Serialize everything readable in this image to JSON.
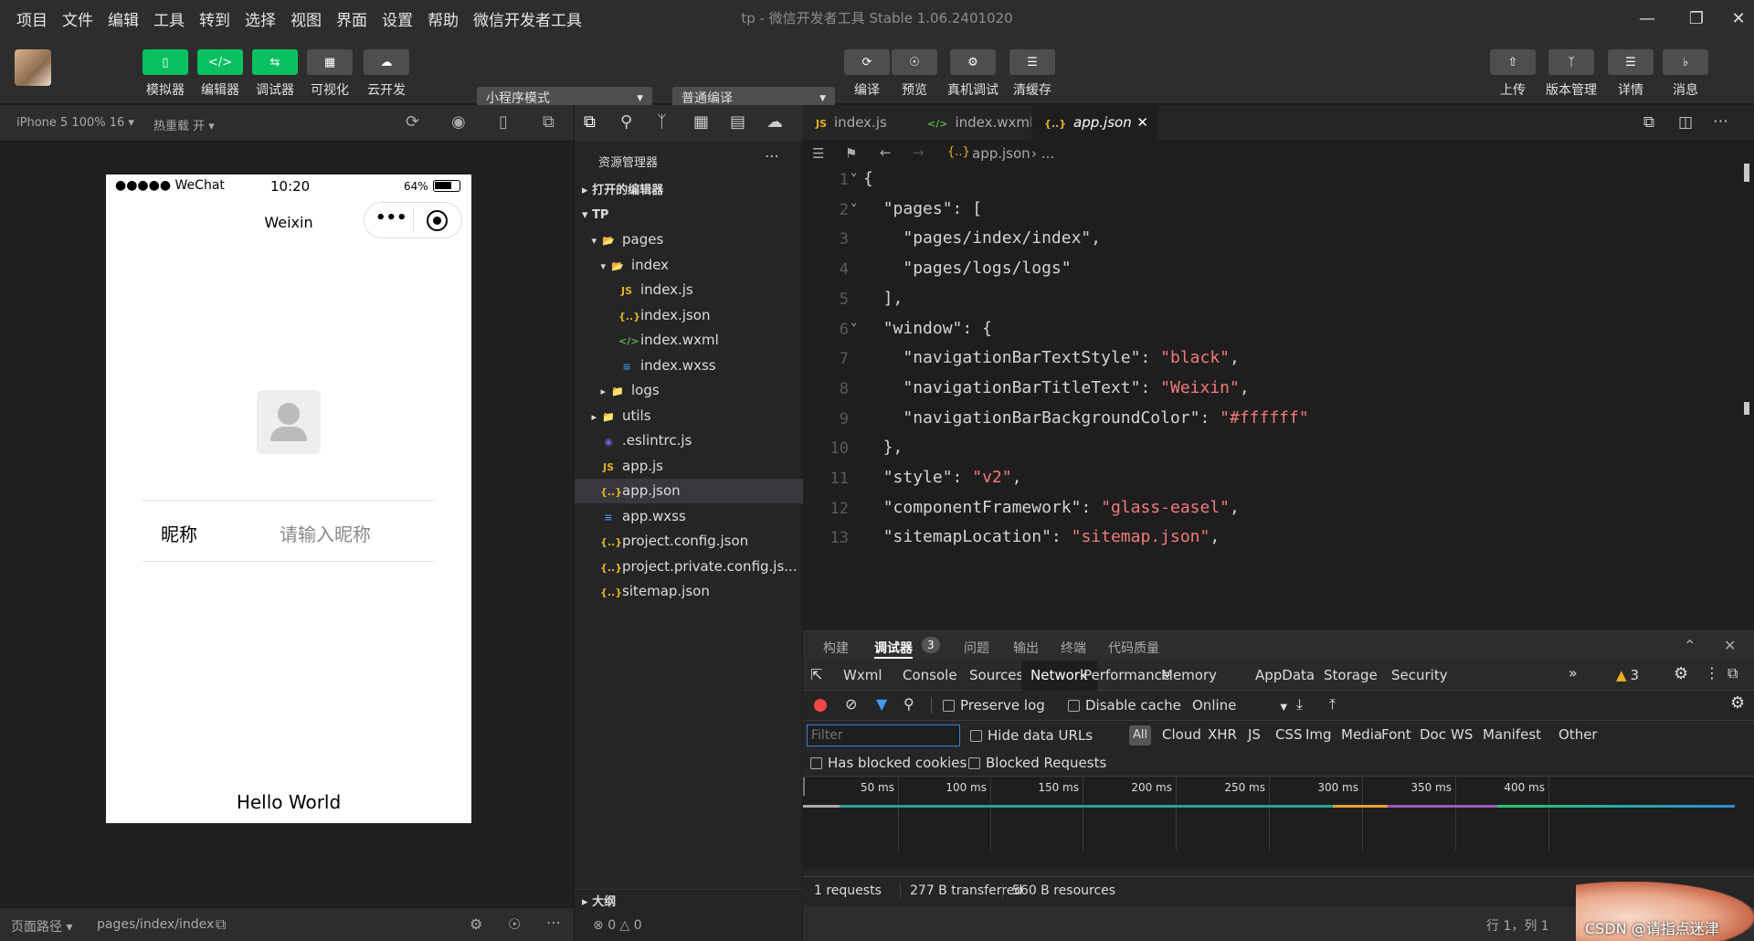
{
  "menu": [
    "项目",
    "文件",
    "编辑",
    "工具",
    "转到",
    "选择",
    "视图",
    "界面",
    "设置",
    "帮助",
    "微信开发者工具"
  ],
  "window_title": "tp - 微信开发者工具 Stable 1.06.2401020",
  "toolbar": {
    "left_buttons": [
      {
        "label": "模拟器",
        "icon": "phone-icon",
        "color": "green"
      },
      {
        "label": "编辑器",
        "icon": "code-icon",
        "color": "green"
      },
      {
        "label": "调试器",
        "icon": "debug-icon",
        "color": "green"
      },
      {
        "label": "可视化",
        "icon": "layout-icon",
        "color": "grey"
      },
      {
        "label": "云开发",
        "icon": "cloud-icon",
        "color": "grey"
      }
    ],
    "mode_select": "小程序模式",
    "compile_select": "普通编译",
    "mid_buttons": [
      {
        "label": "编译",
        "icon": "refresh-icon"
      },
      {
        "label": "预览",
        "icon": "eye-icon"
      },
      {
        "label": "真机调试",
        "icon": "bug-icon"
      },
      {
        "label": "清缓存",
        "icon": "layers-icon"
      }
    ],
    "right_buttons": [
      {
        "label": "上传",
        "icon": "upload-icon"
      },
      {
        "label": "版本管理",
        "icon": "branch-icon"
      },
      {
        "label": "详情",
        "icon": "menu-icon"
      },
      {
        "label": "消息",
        "icon": "bell-icon"
      }
    ]
  },
  "simulator": {
    "device": "iPhone 5 100% 16",
    "hot_reload": "热重载 开",
    "phone": {
      "carrier": "●●●●● WeChat",
      "time": "10:20",
      "battery": "64%",
      "nav_title": "Weixin",
      "nickname_label": "昵称",
      "nickname_placeholder": "请输入昵称",
      "motto": "Hello World"
    },
    "footer_label": "页面路径",
    "footer_path": "pages/index/index"
  },
  "explorer": {
    "title": "资源管理器",
    "open_editors": "打开的编辑器",
    "root": "TP",
    "outline": "大纲",
    "status_errors": "0",
    "status_warnings": "0",
    "files": [
      {
        "name": "pages",
        "indent": 1,
        "type": "folder-open",
        "arrow": "▾"
      },
      {
        "name": "index",
        "indent": 2,
        "type": "folder-open",
        "arrow": "▾"
      },
      {
        "name": "index.js",
        "indent": 3,
        "type": "js"
      },
      {
        "name": "index.json",
        "indent": 3,
        "type": "json"
      },
      {
        "name": "index.wxml",
        "indent": 3,
        "type": "wxml"
      },
      {
        "name": "index.wxss",
        "indent": 3,
        "type": "wxss"
      },
      {
        "name": "logs",
        "indent": 2,
        "type": "folder",
        "arrow": "▸"
      },
      {
        "name": "utils",
        "indent": 1,
        "type": "folder",
        "arrow": "▸"
      },
      {
        "name": ".eslintrc.js",
        "indent": 1,
        "type": "eslint"
      },
      {
        "name": "app.js",
        "indent": 1,
        "type": "js"
      },
      {
        "name": "app.json",
        "indent": 1,
        "type": "json",
        "selected": true
      },
      {
        "name": "app.wxss",
        "indent": 1,
        "type": "wxss"
      },
      {
        "name": "project.config.json",
        "indent": 1,
        "type": "json"
      },
      {
        "name": "project.private.config.js...",
        "indent": 1,
        "type": "json"
      },
      {
        "name": "sitemap.json",
        "indent": 1,
        "type": "json"
      }
    ]
  },
  "editor": {
    "tabs": [
      {
        "name": "index.js",
        "type": "js"
      },
      {
        "name": "index.wxml",
        "type": "wxml"
      },
      {
        "name": "app.json",
        "type": "json",
        "active": true
      }
    ],
    "breadcrumb_file": "app.json",
    "breadcrumb_more": "...",
    "lines": [
      {
        "n": "1",
        "text": "{"
      },
      {
        "n": "2",
        "text": "  \"pages\": ["
      },
      {
        "n": "3",
        "text": "    \"pages/index/index\","
      },
      {
        "n": "4",
        "text": "    \"pages/logs/logs\""
      },
      {
        "n": "5",
        "text": "  ],"
      },
      {
        "n": "6",
        "text": "  \"window\": {"
      },
      {
        "n": "7",
        "text": "    \"navigationBarTextStyle\": \"black\","
      },
      {
        "n": "8",
        "text": "    \"navigationBarTitleText\": \"Weixin\","
      },
      {
        "n": "9",
        "text": "    \"navigationBarBackgroundColor\": \"#ffffff\""
      },
      {
        "n": "10",
        "text": "  },"
      },
      {
        "n": "11",
        "text": "  \"style\": \"v2\","
      },
      {
        "n": "12",
        "text": "  \"componentFramework\": \"glass-easel\","
      },
      {
        "n": "13",
        "text": "  \"sitemapLocation\": \"sitemap.json\","
      }
    ],
    "cursor": "行 1，列 1"
  },
  "devtools": {
    "top_tabs": [
      "构建",
      "调试器",
      "问题",
      "输出",
      "终端",
      "代码质量"
    ],
    "debugger_badge": "3",
    "tabs": [
      "Wxml",
      "Console",
      "Sources",
      "Network",
      "Performance",
      "Memory",
      "AppData",
      "Storage",
      "Security"
    ],
    "active_tab": "Network",
    "warn_count": "3",
    "preserve_log": "Preserve log",
    "disable_cache": "Disable cache",
    "throttle": "Online",
    "filter_placeholder": "Filter",
    "hide_data_urls": "Hide data URLs",
    "types": [
      "All",
      "Cloud",
      "XHR",
      "JS",
      "CSS",
      "Img",
      "Media",
      "Font",
      "Doc",
      "WS",
      "Manifest",
      "Other"
    ],
    "has_blocked_cookies": "Has blocked cookies",
    "blocked_requests": "Blocked Requests",
    "timeline_ticks": [
      "50 ms",
      "100 ms",
      "150 ms",
      "200 ms",
      "250 ms",
      "300 ms",
      "350 ms",
      "400 ms"
    ],
    "summary": [
      "1 requests",
      "277 B transferred",
      "560 B resources"
    ]
  },
  "watermark": "CSDN @请指点迷津"
}
